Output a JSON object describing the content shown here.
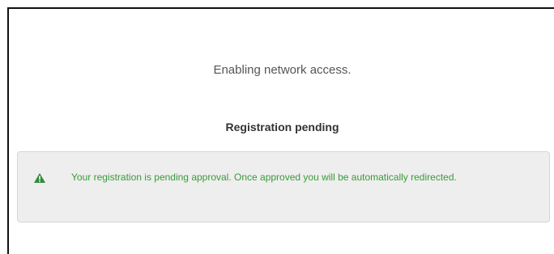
{
  "page": {
    "status_message": "Enabling network access.",
    "heading": "Registration pending"
  },
  "alert": {
    "icon": "warning-triangle-icon",
    "message": "Your registration is pending approval. Once approved you will be automatically redirected.",
    "text_color": "#3a9a3a",
    "icon_color": "#2e8b3a",
    "background": "#eeeeee"
  }
}
